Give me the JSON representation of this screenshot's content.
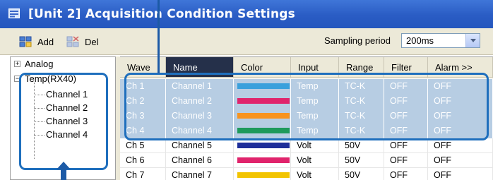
{
  "window": {
    "title": "[Unit 2] Acquisition Condition Settings"
  },
  "toolbar": {
    "add_label": "Add",
    "del_label": "Del",
    "sampling_label": "Sampling period",
    "sampling_value": "200ms"
  },
  "tree": {
    "analog_label": "Analog",
    "module_label": "Temp(RX40)",
    "channels": [
      "Channel 1",
      "Channel 2",
      "Channel 3",
      "Channel 4"
    ]
  },
  "grid": {
    "headers": {
      "wave": "Wave",
      "name": "Name",
      "color": "Color",
      "input": "Input",
      "range": "Range",
      "filter": "Filter",
      "alarm": "Alarm >>"
    },
    "rows": [
      {
        "ch": "Ch 1",
        "name": "Channel 1",
        "color": "#3aa0dc",
        "input": "Temp",
        "range": "TC-K",
        "filter": "OFF",
        "alarm": "OFF",
        "selected": true
      },
      {
        "ch": "Ch 2",
        "name": "Channel 2",
        "color": "#e0246c",
        "input": "Temp",
        "range": "TC-K",
        "filter": "OFF",
        "alarm": "OFF",
        "selected": true
      },
      {
        "ch": "Ch 3",
        "name": "Channel 3",
        "color": "#f7931e",
        "input": "Temp",
        "range": "TC-K",
        "filter": "OFF",
        "alarm": "OFF",
        "selected": true
      },
      {
        "ch": "Ch 4",
        "name": "Channel 4",
        "color": "#1f9a5c",
        "input": "Temp",
        "range": "TC-K",
        "filter": "OFF",
        "alarm": "OFF",
        "selected": true
      },
      {
        "ch": "Ch 5",
        "name": "Channel 5",
        "color": "#1e2e99",
        "input": "Volt",
        "range": "50V",
        "filter": "OFF",
        "alarm": "OFF",
        "selected": false
      },
      {
        "ch": "Ch 6",
        "name": "Channel 6",
        "color": "#e0246c",
        "input": "Volt",
        "range": "50V",
        "filter": "OFF",
        "alarm": "OFF",
        "selected": false
      },
      {
        "ch": "Ch 7",
        "name": "Channel 7",
        "color": "#f2c400",
        "input": "Volt",
        "range": "50V",
        "filter": "OFF",
        "alarm": "OFF",
        "selected": false
      }
    ]
  },
  "colors": {
    "titlebar": "#2a5cc4",
    "highlight": "#1f6fbd",
    "selected_row": "#b7cde3"
  }
}
